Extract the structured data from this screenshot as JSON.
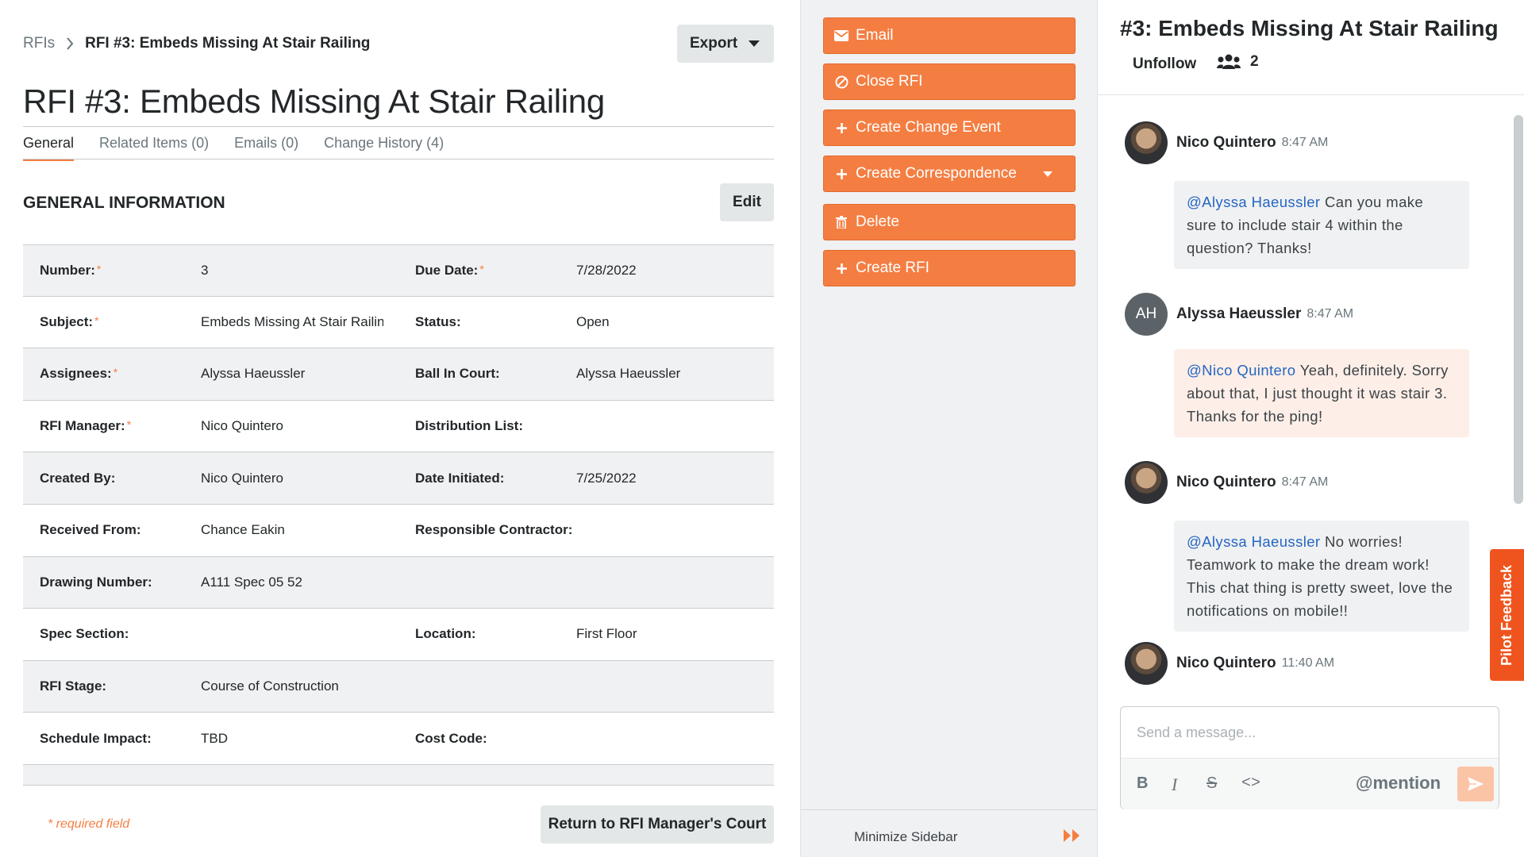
{
  "breadcrumb": {
    "root": "RFIs",
    "current": "RFI #3: Embeds Missing At Stair Railing"
  },
  "export_label": "Export",
  "page_title": "RFI #3: Embeds Missing At Stair Railing",
  "tabs": [
    {
      "label": "General",
      "active": true
    },
    {
      "label": "Related Items (0)",
      "active": false
    },
    {
      "label": "Emails (0)",
      "active": false
    },
    {
      "label": "Change History (4)",
      "active": false
    }
  ],
  "section_title": "GENERAL INFORMATION",
  "edit_label": "Edit",
  "required_mark": "*",
  "rows": [
    {
      "l1": "Number:",
      "r1": true,
      "v1": "3",
      "l2": "Due Date:",
      "r2": true,
      "v2": "7/28/2022"
    },
    {
      "l1": "Subject:",
      "r1": true,
      "v1": "Embeds Missing At Stair Railing",
      "l2": "Status:",
      "r2": false,
      "v2": "Open"
    },
    {
      "l1": "Assignees:",
      "r1": true,
      "v1": "Alyssa Haeussler",
      "l2": "Ball In Court:",
      "r2": false,
      "v2": "Alyssa Haeussler"
    },
    {
      "l1": "RFI Manager:",
      "r1": true,
      "v1": "Nico Quintero",
      "l2": "Distribution List:",
      "r2": false,
      "v2": ""
    },
    {
      "l1": "Created By:",
      "r1": false,
      "v1": "Nico Quintero",
      "l2": "Date Initiated:",
      "r2": false,
      "v2": "7/25/2022"
    },
    {
      "l1": "Received From:",
      "r1": false,
      "v1": "Chance Eakin",
      "l2": "Responsible Contractor:",
      "r2": false,
      "v2": ""
    },
    {
      "l1": "Drawing Number:",
      "r1": false,
      "v1": "A111 Spec 05 52",
      "l2": "",
      "r2": false,
      "v2": ""
    },
    {
      "l1": "Spec Section:",
      "r1": false,
      "v1": "",
      "l2": "Location:",
      "r2": false,
      "v2": "First Floor"
    },
    {
      "l1": "RFI Stage:",
      "r1": false,
      "v1": "Course of Construction",
      "l2": "",
      "r2": false,
      "v2": ""
    },
    {
      "l1": "Schedule Impact:",
      "r1": false,
      "v1": "TBD",
      "l2": "Cost Code:",
      "r2": false,
      "v2": ""
    }
  ],
  "required_note": "* required field",
  "return_label": "Return to RFI Manager's Court",
  "actions": [
    {
      "label": "Email",
      "icon": "envelope-icon"
    },
    {
      "label": "Close RFI",
      "icon": "ban-icon"
    },
    {
      "label": "Create Change Event",
      "icon": "plus-icon"
    },
    {
      "label": "Create Correspondence",
      "icon": "plus-icon",
      "dropdown": true
    },
    {
      "label": "Delete",
      "icon": "trash-icon"
    },
    {
      "label": "Create RFI",
      "icon": "plus-icon"
    }
  ],
  "minimize_label": "Minimize Sidebar",
  "chat": {
    "title": "#3: Embeds Missing At Stair Railing",
    "unfollow": "Unfollow",
    "followers_count": "2",
    "messages": [
      {
        "author": "Nico Quintero",
        "time": "8:47 AM",
        "avatar": "photo",
        "mention": "@Alyssa Haeussler",
        "text": " Can you make sure to include stair 4 within the question? Thanks!",
        "own": false
      },
      {
        "author": "Alyssa Haeussler",
        "time": "8:47 AM",
        "avatar": "AH",
        "mention": "@Nico Quintero",
        "text": " Yeah, definitely. Sorry about that, I just thought it was stair 3. Thanks for the ping!",
        "own": true
      },
      {
        "author": "Nico Quintero",
        "time": "8:47 AM",
        "avatar": "photo",
        "mention": "@Alyssa Haeussler",
        "text": " No worries! Teamwork to make the dream work! This chat thing is pretty sweet, love the notifications on mobile!!",
        "own": false
      },
      {
        "author": "Nico Quintero",
        "time": "11:40 AM",
        "avatar": "photo",
        "mention": "",
        "text": "",
        "own": false
      }
    ],
    "composer_placeholder": "Send a message...",
    "tools": {
      "bold": "B",
      "italic": "I",
      "strike": "S",
      "code": "<>",
      "mention": "@mention"
    },
    "feedback_label": "Pilot Feedback"
  },
  "colors": {
    "accent": "#f47e42",
    "mention": "#2566c2",
    "feedback": "#f0541e"
  }
}
